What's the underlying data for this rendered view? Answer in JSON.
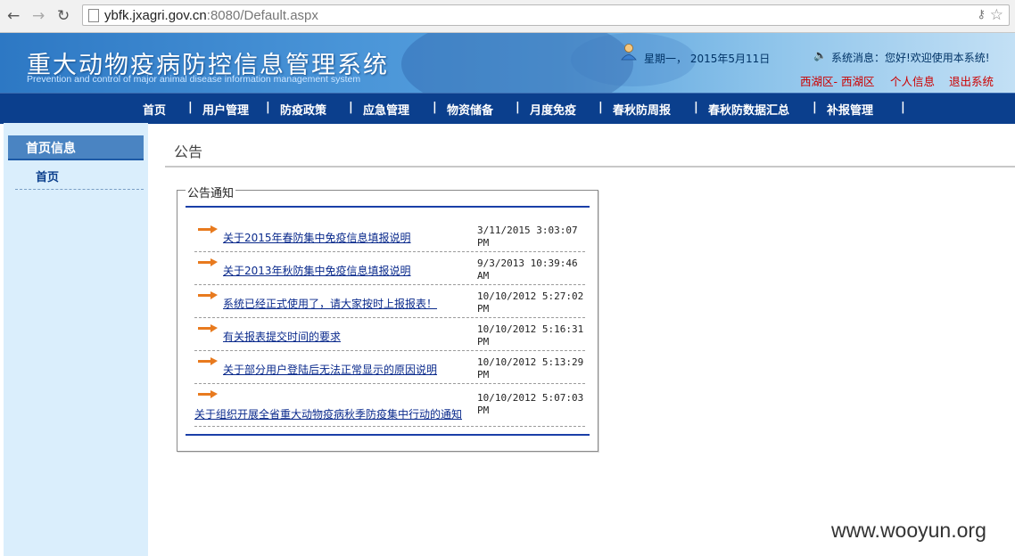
{
  "browser": {
    "url_host": "ybfk.jxagri.gov.cn",
    "url_port": ":8080",
    "url_path": "/Default.aspx"
  },
  "header": {
    "title_cn": "重大动物疫病防控信息管理系统",
    "title_en": "Prevention and control of major animal disease information management system",
    "date": "星期一，  2015年5月11日",
    "system_message": "系统消息：您好!欢迎使用本系统!",
    "region": "西湖区- 西湖区",
    "personal_info": "个人信息",
    "logout": "退出系统"
  },
  "menu": [
    "首页",
    "用户管理",
    "防疫政策",
    "应急管理",
    "物资储备",
    "月度免疫",
    "春秋防周报",
    "春秋防数据汇总",
    "补报管理"
  ],
  "menu_separator": "|",
  "sidebar": {
    "heading": "首页信息",
    "items": [
      "首页"
    ]
  },
  "main": {
    "breadcrumb": "公告",
    "notice_legend": "公告通知",
    "notices": [
      {
        "title": "关于2015年春防集中免疫信息填报说明",
        "time_line1": "3/11/2015 3:03:07 PM",
        "time_line2": ""
      },
      {
        "title": "关于2013年秋防集中免疫信息填报说明",
        "time_line1": "9/3/2013 10:39:46 AM",
        "time_line2": ""
      },
      {
        "title": "系统已经正式使用了，请大家按时上报报表！",
        "time_line1": "10/10/2012 5:27:02",
        "time_line2": "PM"
      },
      {
        "title": "有关报表提交时间的要求",
        "time_line1": "10/10/2012 5:16:31",
        "time_line2": "PM"
      },
      {
        "title": "关于部分用户登陆后无法正常显示的原因说明",
        "time_line1": "10/10/2012 5:13:29",
        "time_line2": "PM"
      },
      {
        "title": "关于组织开展全省重大动物疫病秋季防疫集中行动的通知",
        "time_line1": "10/10/2012 5:07:03",
        "time_line2": "PM"
      }
    ]
  },
  "watermark": "www.wooyun.org"
}
